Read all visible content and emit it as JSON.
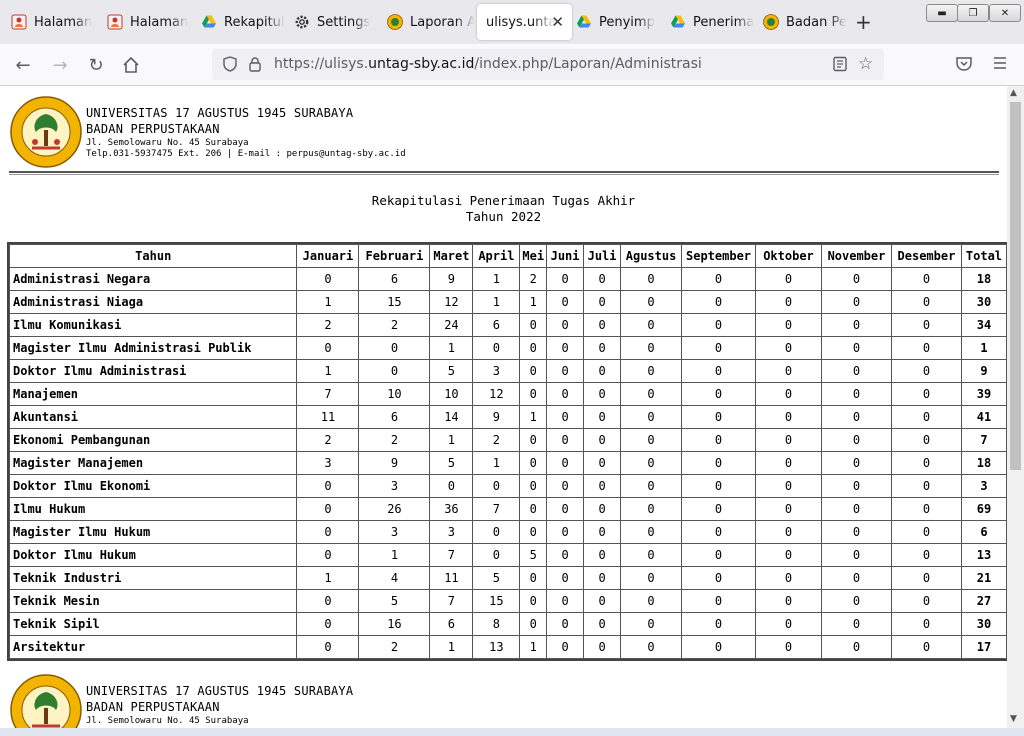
{
  "browser": {
    "tabs": [
      {
        "label": "Halaman",
        "icon": "scholar-icon"
      },
      {
        "label": "Halaman",
        "icon": "scholar-icon"
      },
      {
        "label": "Rekapitul",
        "icon": "drive-icon"
      },
      {
        "label": "Settings",
        "icon": "gear-icon"
      },
      {
        "label": "Laporan A",
        "icon": "university-logo-icon"
      },
      {
        "label": "ulisys.unta",
        "icon": "",
        "active": true
      },
      {
        "label": "Penyimp",
        "icon": "drive-icon"
      },
      {
        "label": "Penerima",
        "icon": "drive-icon"
      },
      {
        "label": "Badan Pe",
        "icon": "university-logo-icon"
      }
    ],
    "url_prefix": "https://ulisys.",
    "url_domain": "untag-sby.ac.id",
    "url_path": "/index.php/Laporan/Administrasi"
  },
  "header": {
    "university": "UNIVERSITAS 17 AGUSTUS 1945 SURABAYA",
    "department": "BADAN PERPUSTAKAAN",
    "address": "Jl. Semolowaru No. 45 Surabaya",
    "contact": "Telp.031-5937475 Ext. 206 | E-mail : perpus@untag-sby.ac.id"
  },
  "report": {
    "title": "Rekapitulasi Penerimaan Tugas Akhir",
    "year_label": "Tahun 2022"
  },
  "table": {
    "columns": [
      "Tahun",
      "Januari",
      "Februari",
      "Maret",
      "April",
      "Mei",
      "Juni",
      "Juli",
      "Agustus",
      "September",
      "Oktober",
      "November",
      "Desember",
      "Total"
    ],
    "rows": [
      [
        "Administrasi Negara",
        "0",
        "6",
        "9",
        "1",
        "2",
        "0",
        "0",
        "0",
        "0",
        "0",
        "0",
        "0",
        "18"
      ],
      [
        "Administrasi Niaga",
        "1",
        "15",
        "12",
        "1",
        "1",
        "0",
        "0",
        "0",
        "0",
        "0",
        "0",
        "0",
        "30"
      ],
      [
        "Ilmu Komunikasi",
        "2",
        "2",
        "24",
        "6",
        "0",
        "0",
        "0",
        "0",
        "0",
        "0",
        "0",
        "0",
        "34"
      ],
      [
        "Magister Ilmu Administrasi Publik",
        "0",
        "0",
        "1",
        "0",
        "0",
        "0",
        "0",
        "0",
        "0",
        "0",
        "0",
        "0",
        "1"
      ],
      [
        "Doktor Ilmu Administrasi",
        "1",
        "0",
        "5",
        "3",
        "0",
        "0",
        "0",
        "0",
        "0",
        "0",
        "0",
        "0",
        "9"
      ],
      [
        "Manajemen",
        "7",
        "10",
        "10",
        "12",
        "0",
        "0",
        "0",
        "0",
        "0",
        "0",
        "0",
        "0",
        "39"
      ],
      [
        "Akuntansi",
        "11",
        "6",
        "14",
        "9",
        "1",
        "0",
        "0",
        "0",
        "0",
        "0",
        "0",
        "0",
        "41"
      ],
      [
        "Ekonomi Pembangunan",
        "2",
        "2",
        "1",
        "2",
        "0",
        "0",
        "0",
        "0",
        "0",
        "0",
        "0",
        "0",
        "7"
      ],
      [
        "Magister Manajemen",
        "3",
        "9",
        "5",
        "1",
        "0",
        "0",
        "0",
        "0",
        "0",
        "0",
        "0",
        "0",
        "18"
      ],
      [
        "Doktor Ilmu Ekonomi",
        "0",
        "3",
        "0",
        "0",
        "0",
        "0",
        "0",
        "0",
        "0",
        "0",
        "0",
        "0",
        "3"
      ],
      [
        "Ilmu Hukum",
        "0",
        "26",
        "36",
        "7",
        "0",
        "0",
        "0",
        "0",
        "0",
        "0",
        "0",
        "0",
        "69"
      ],
      [
        "Magister Ilmu Hukum",
        "0",
        "3",
        "3",
        "0",
        "0",
        "0",
        "0",
        "0",
        "0",
        "0",
        "0",
        "0",
        "6"
      ],
      [
        "Doktor Ilmu Hukum",
        "0",
        "1",
        "7",
        "0",
        "5",
        "0",
        "0",
        "0",
        "0",
        "0",
        "0",
        "0",
        "13"
      ],
      [
        "Teknik Industri",
        "1",
        "4",
        "11",
        "5",
        "0",
        "0",
        "0",
        "0",
        "0",
        "0",
        "0",
        "0",
        "21"
      ],
      [
        "Teknik Mesin",
        "0",
        "5",
        "7",
        "15",
        "0",
        "0",
        "0",
        "0",
        "0",
        "0",
        "0",
        "0",
        "27"
      ],
      [
        "Teknik Sipil",
        "0",
        "16",
        "6",
        "8",
        "0",
        "0",
        "0",
        "0",
        "0",
        "0",
        "0",
        "0",
        "30"
      ],
      [
        "Arsitektur",
        "0",
        "2",
        "1",
        "13",
        "1",
        "0",
        "0",
        "0",
        "0",
        "0",
        "0",
        "0",
        "17"
      ]
    ]
  }
}
